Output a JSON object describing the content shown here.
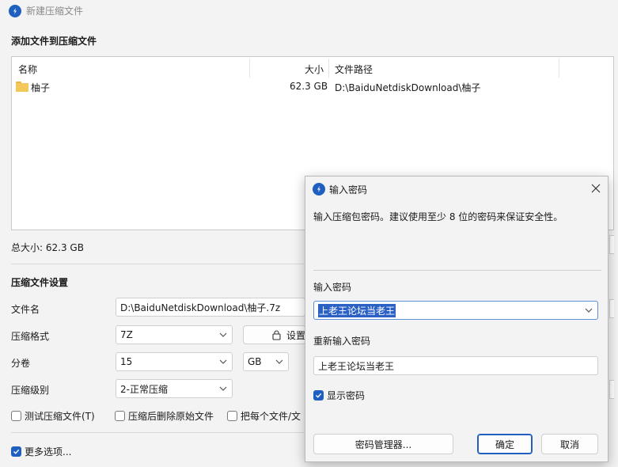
{
  "window": {
    "title": "新建压缩文件",
    "add_section_title": "添加文件到压缩文件",
    "columns": [
      "名称",
      "大小",
      "文件路径"
    ],
    "files": [
      {
        "name": "柚子",
        "size": "62.3 GB",
        "path": "D:\\BaiduNetdiskDownload\\柚子",
        "icon": "folder-icon"
      }
    ],
    "total_size": "总大小: 62.3 GB",
    "settings_title": "压缩文件设置",
    "filename_label": "文件名",
    "filename_value": "D:\\BaiduNetdiskDownload\\柚子.7z",
    "format_label": "压缩格式",
    "format_value": "7Z",
    "password_button": "设置",
    "volume_label": "分卷",
    "volume_value": "15",
    "volume_unit": "GB",
    "level_label": "压缩级别",
    "level_value": "2-正常压缩",
    "checkboxes": [
      {
        "label": "测试压缩文件(T)",
        "checked": false
      },
      {
        "label": "压缩后删除原始文件",
        "checked": false
      },
      {
        "label": "把每个文件/文",
        "checked": false
      }
    ],
    "more_options": {
      "label": "更多选项...",
      "checked": true
    }
  },
  "dialog": {
    "title": "输入密码",
    "description": "输入压缩包密码。建议使用至少 8 位的密码来保证安全性。",
    "password_label": "输入密码",
    "password_value": "上老王论坛当老王",
    "confirm_label": "重新输入密码",
    "confirm_value": "上老王论坛当老王",
    "show_password": {
      "label": "显示密码",
      "checked": true
    },
    "manager_button": "密码管理器...",
    "ok_button": "确定",
    "cancel_button": "取消"
  },
  "colors": {
    "accent": "#1f5fbf",
    "selection": "#2b61c4"
  }
}
